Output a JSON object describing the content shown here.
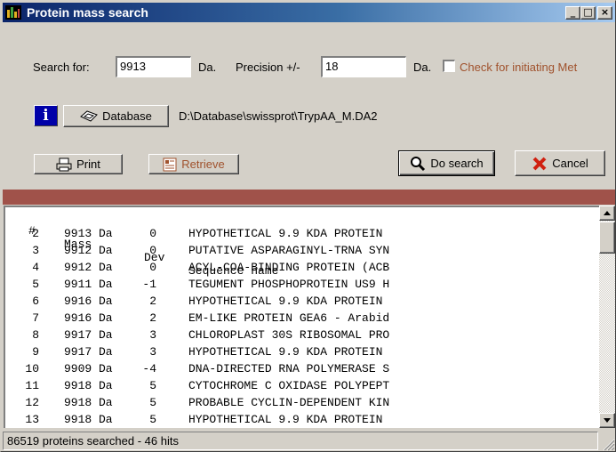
{
  "window": {
    "title": "Protein mass search"
  },
  "titlebar": {
    "minimize": "_",
    "maximize": "□",
    "close": "×"
  },
  "search": {
    "label": "Search for:",
    "value": "9913",
    "unit1": "Da.",
    "precision_label": "Precision +/-",
    "precision_value": "18",
    "unit2": "Da.",
    "met_checkbox_label": "Check for initiating Met",
    "met_checked": false
  },
  "database": {
    "info_label": "i",
    "button_label": "Database",
    "path": "D:\\Database\\swissprot\\TrypAA_M.DA2"
  },
  "actions": {
    "print_label": "Print",
    "retrieve_label": "Retrieve",
    "search_label": "Do search",
    "cancel_label": "Cancel"
  },
  "results": {
    "columns": [
      "#",
      "Mass",
      "Dev",
      "Sequence name"
    ],
    "rows": [
      {
        "num": "2",
        "mass": "9913 Da",
        "dev": "0",
        "name": "HYPOTHETICAL 9.9 KDA PROTEIN"
      },
      {
        "num": "3",
        "mass": "9912 Da",
        "dev": "0",
        "name": "PUTATIVE ASPARAGINYL-TRNA SYN"
      },
      {
        "num": "4",
        "mass": "9912 Da",
        "dev": "0",
        "name": "ACYL-COA-BINDING PROTEIN (ACB"
      },
      {
        "num": "5",
        "mass": "9911 Da",
        "dev": "-1",
        "name": "TEGUMENT PHOSPHOPROTEIN US9 H"
      },
      {
        "num": "6",
        "mass": "9916 Da",
        "dev": "2",
        "name": "HYPOTHETICAL 9.9 KDA PROTEIN"
      },
      {
        "num": "7",
        "mass": "9916 Da",
        "dev": "2",
        "name": "EM-LIKE PROTEIN GEA6 - Arabid"
      },
      {
        "num": "8",
        "mass": "9917 Da",
        "dev": "3",
        "name": "CHLOROPLAST 30S RIBOSOMAL PRO"
      },
      {
        "num": "9",
        "mass": "9917 Da",
        "dev": "3",
        "name": "HYPOTHETICAL 9.9 KDA PROTEIN"
      },
      {
        "num": "10",
        "mass": "9909 Da",
        "dev": "-4",
        "name": "DNA-DIRECTED RNA POLYMERASE S"
      },
      {
        "num": "11",
        "mass": "9918 Da",
        "dev": "5",
        "name": "CYTOCHROME C OXIDASE POLYPEPT"
      },
      {
        "num": "12",
        "mass": "9918 Da",
        "dev": "5",
        "name": "PROBABLE CYCLIN-DEPENDENT KIN"
      },
      {
        "num": "13",
        "mass": "9918 Da",
        "dev": "5",
        "name": "HYPOTHETICAL 9.9 KDA PROTEIN"
      }
    ]
  },
  "status": {
    "text": "86519 proteins searched - 46 hits"
  },
  "colors": {
    "title_gradient_start": "#0a246a",
    "title_gradient_end": "#a6caf0",
    "band": "#a0524a",
    "disabled_text": "#a0522d",
    "face": "#d4d0c8"
  }
}
